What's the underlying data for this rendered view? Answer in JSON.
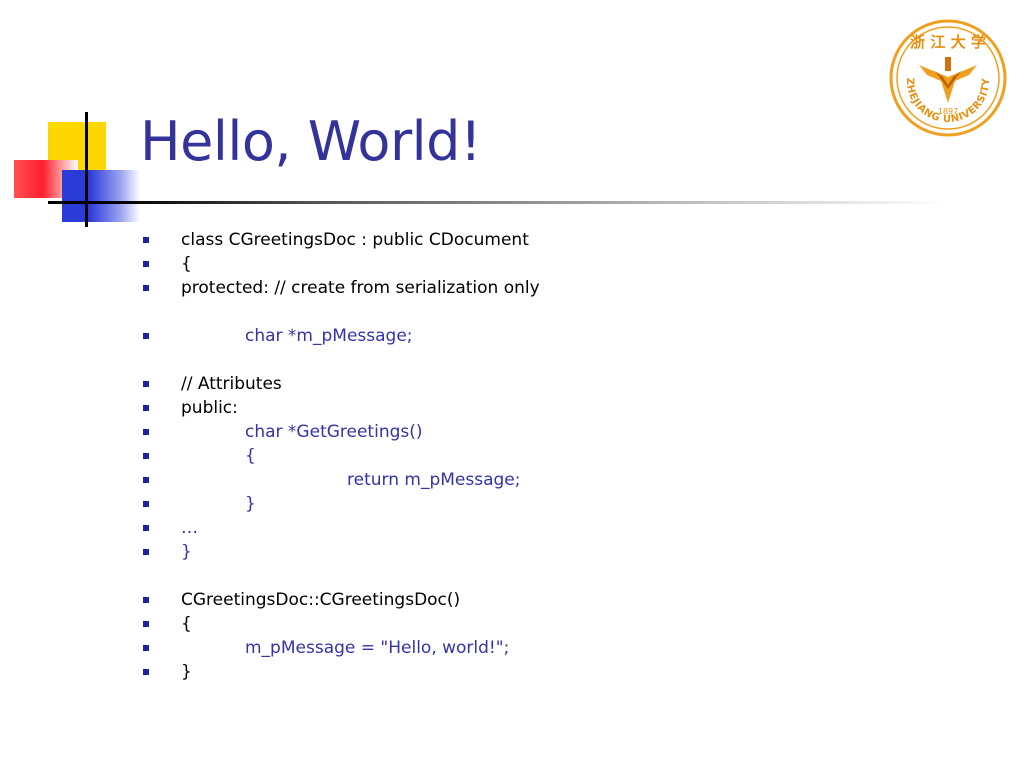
{
  "slide": {
    "title": "Hello, World!",
    "logo": {
      "chinese_text": "浙 江 大 学",
      "year": "1897",
      "english_text": "ZHEJIANG UNIVERSITY"
    },
    "accent_colors": {
      "title": "#333399",
      "bullet": "#1f1fa8",
      "code_blue": "#3333aa",
      "logo_orange": "#f0a020"
    }
  },
  "code_lines": [
    {
      "text": "class CGreetingsDoc : public CDocument",
      "indent": 0,
      "color": "black"
    },
    {
      "text": "{",
      "indent": 0,
      "color": "black"
    },
    {
      "text": "protected: // create from serialization only",
      "indent": 0,
      "color": "black"
    },
    {
      "text": "char *m_pMessage;",
      "indent": 1,
      "color": "blue"
    },
    {
      "text": "// Attributes",
      "indent": 0,
      "color": "black"
    },
    {
      "text": "public:",
      "indent": 0,
      "color": "black"
    },
    {
      "text": "char *GetGreetings()",
      "indent": 1,
      "color": "blue"
    },
    {
      "text": "{",
      "indent": 1,
      "color": "blue"
    },
    {
      "text": "return m_pMessage;",
      "indent": 2,
      "color": "blue"
    },
    {
      "text": "}",
      "indent": 1,
      "color": "blue"
    },
    {
      "text": "…",
      "indent": 0,
      "color": "blue"
    },
    {
      "text": "}",
      "indent": 0,
      "color": "blue"
    },
    {
      "text": "CGreetingsDoc::CGreetingsDoc()",
      "indent": 0,
      "color": "black"
    },
    {
      "text": "{",
      "indent": 0,
      "color": "black"
    },
    {
      "text": "m_pMessage = \"Hello, world!\";",
      "indent": 1,
      "color": "blue"
    },
    {
      "text": "}",
      "indent": 0,
      "color": "black"
    }
  ]
}
